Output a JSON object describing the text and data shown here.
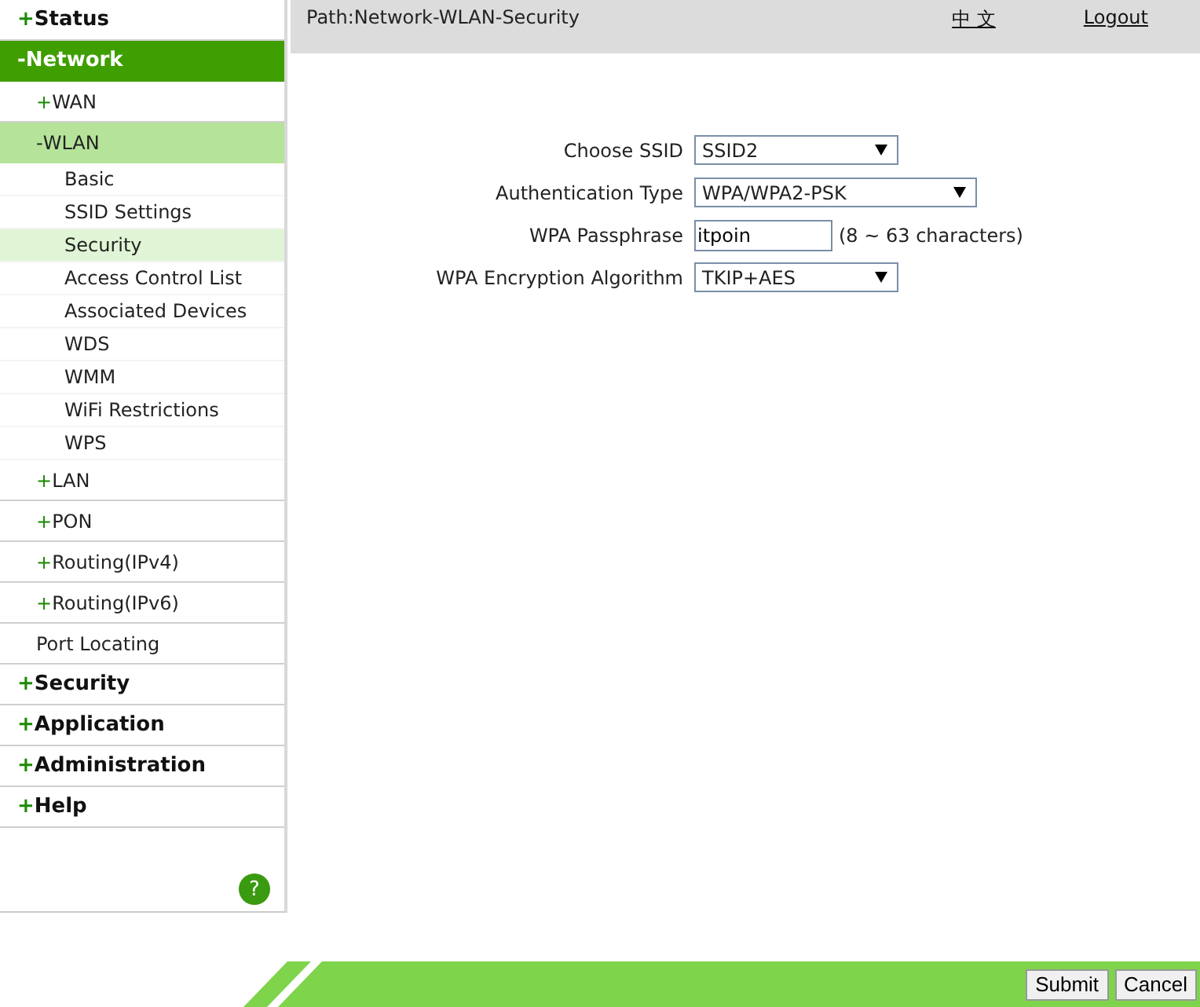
{
  "sidebar": {
    "items": [
      {
        "sign": "+",
        "label": "Status",
        "selected": false
      },
      {
        "sign": "-",
        "label": "Network",
        "selected": true,
        "children": [
          {
            "sign": "+",
            "label": "WAN",
            "selected": false
          },
          {
            "sign": "-",
            "label": "WLAN",
            "selected": true,
            "children": [
              {
                "label": "Basic",
                "selected": false
              },
              {
                "label": "SSID Settings",
                "selected": false
              },
              {
                "label": "Security",
                "selected": true
              },
              {
                "label": "Access Control List",
                "selected": false
              },
              {
                "label": "Associated Devices",
                "selected": false
              },
              {
                "label": "WDS",
                "selected": false
              },
              {
                "label": "WMM",
                "selected": false
              },
              {
                "label": "WiFi Restrictions",
                "selected": false
              },
              {
                "label": "WPS",
                "selected": false
              }
            ]
          },
          {
            "sign": "+",
            "label": "LAN",
            "selected": false
          },
          {
            "sign": "+",
            "label": "PON",
            "selected": false
          },
          {
            "sign": "+",
            "label": "Routing(IPv4)",
            "selected": false
          },
          {
            "sign": "+",
            "label": "Routing(IPv6)",
            "selected": false
          },
          {
            "label": "Port Locating",
            "selected": false
          }
        ]
      },
      {
        "sign": "+",
        "label": "Security",
        "selected": false
      },
      {
        "sign": "+",
        "label": "Application",
        "selected": false
      },
      {
        "sign": "+",
        "label": "Administration",
        "selected": false
      },
      {
        "sign": "+",
        "label": "Help",
        "selected": false
      }
    ],
    "help": "?"
  },
  "header": {
    "path": "Path:Network-WLAN-Security",
    "links": [
      "中 文",
      "Logout"
    ]
  },
  "form": {
    "fields": [
      {
        "kind": "select",
        "label": "Choose SSID",
        "value": "SSID2"
      },
      {
        "kind": "select",
        "label": "Authentication Type",
        "value": "WPA/WPA2-PSK"
      },
      {
        "kind": "text",
        "label": "WPA Passphrase",
        "value": "itpoin",
        "hint": "(8 ~ 63 characters)"
      },
      {
        "kind": "select",
        "label": "WPA Encryption Algorithm",
        "value": "TKIP+AES"
      }
    ]
  },
  "buttons": [
    "Submit",
    "Cancel"
  ]
}
